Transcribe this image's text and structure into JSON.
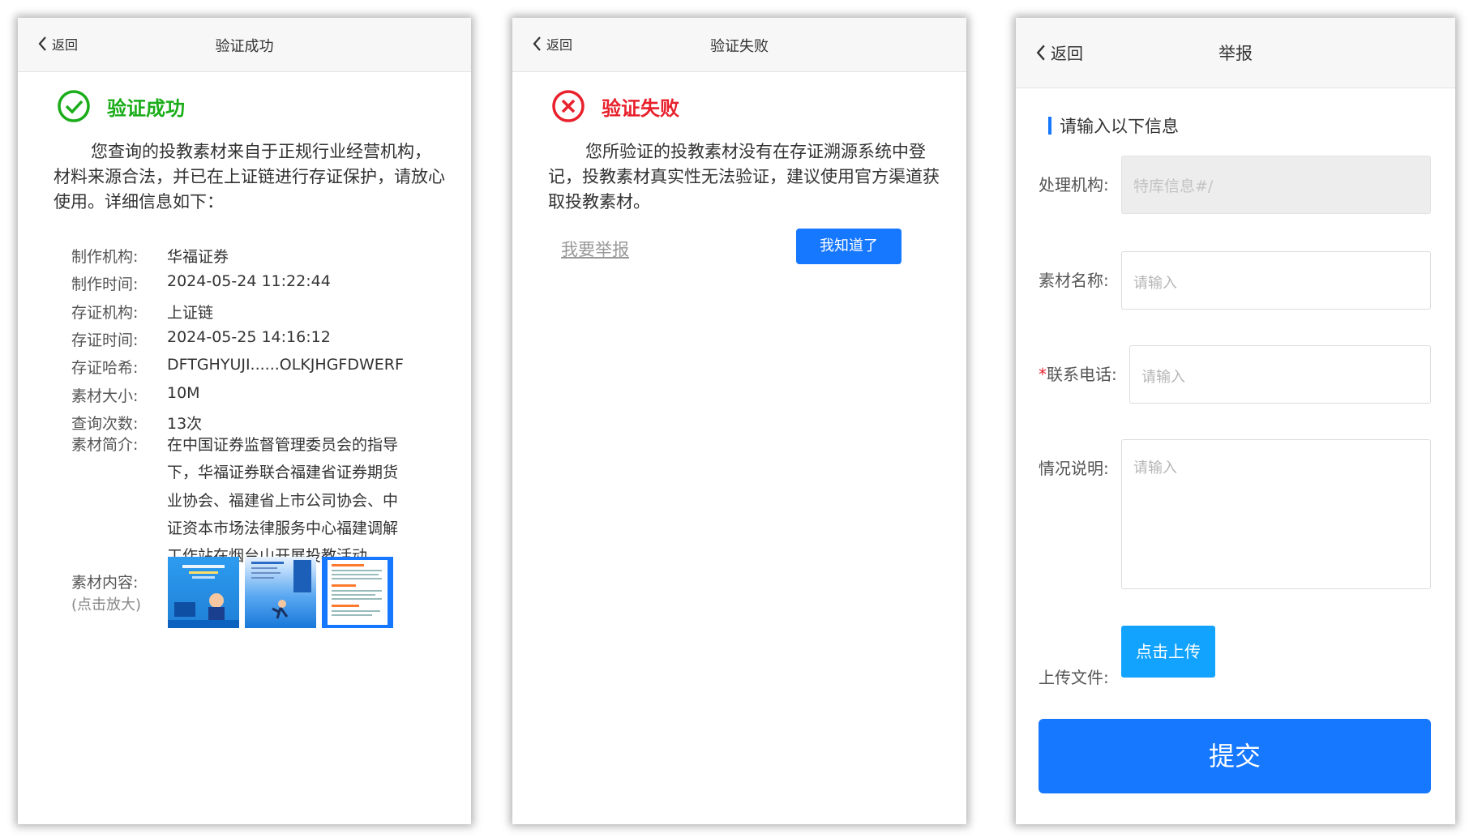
{
  "panel_success": {
    "back_label": "返回",
    "title": "验证成功",
    "status_text": "验证成功",
    "status_color": "#1aad19",
    "description": "您查询的投教素材来自于正规行业经营机构，材料来源合法，并已在上证链进行存证保护，请放心使用。详细信息如下：",
    "details": [
      {
        "label": "制作机构:",
        "value": "华福证券"
      },
      {
        "label": "制作时间:",
        "value": "2024-05-24 11:22:44"
      },
      {
        "label": "存证机构:",
        "value": "上证链"
      },
      {
        "label": "存证时间:",
        "value": "2024-05-25 14:16:12"
      },
      {
        "label": "存证哈希:",
        "value": "DFTGHYUJI......OLKJHGFDWERF"
      },
      {
        "label": "素材大小:",
        "value": "10M"
      },
      {
        "label": "查询次数:",
        "value": "13次"
      }
    ],
    "intro_label": "素材简介:",
    "intro_lines": [
      "在中国证券监督管理委员会的指导",
      "下，华福证券联合福建省证券期货",
      "业协会、福建省上市公司协会、中",
      "证资本市场法律服务中心福建调解",
      "工作站在烟台山开展投教活动"
    ],
    "content_label": "素材内容:",
    "content_hint": "(点击放大)"
  },
  "panel_fail": {
    "back_label": "返回",
    "title": "验证失败",
    "status_text": "验证失败",
    "status_color": "#e8212c",
    "description": "您所验证的投教素材没有在存证溯源系统中登记，投教素材真实性无法验证，建议使用官方渠道获取投教素材。",
    "report_link": "我要举报",
    "ok_button": "我知道了"
  },
  "panel_report": {
    "back_label": "返回",
    "title": "举报",
    "section_title": "请输入以下信息",
    "fields": {
      "org": {
        "label": "处理机构:",
        "value": "特库信息#/"
      },
      "name": {
        "label": "素材名称:",
        "placeholder": "请输入"
      },
      "phone": {
        "required_mark": "*",
        "label": "联系电话:",
        "placeholder": "请输入"
      },
      "desc": {
        "label": "情况说明:",
        "placeholder": "请输入"
      }
    },
    "upload_label": "上传文件:",
    "upload_button": "点击上传",
    "submit_button": "提交"
  },
  "colors": {
    "accent": "#1677ff",
    "header_bg": "#f7f7f7"
  }
}
